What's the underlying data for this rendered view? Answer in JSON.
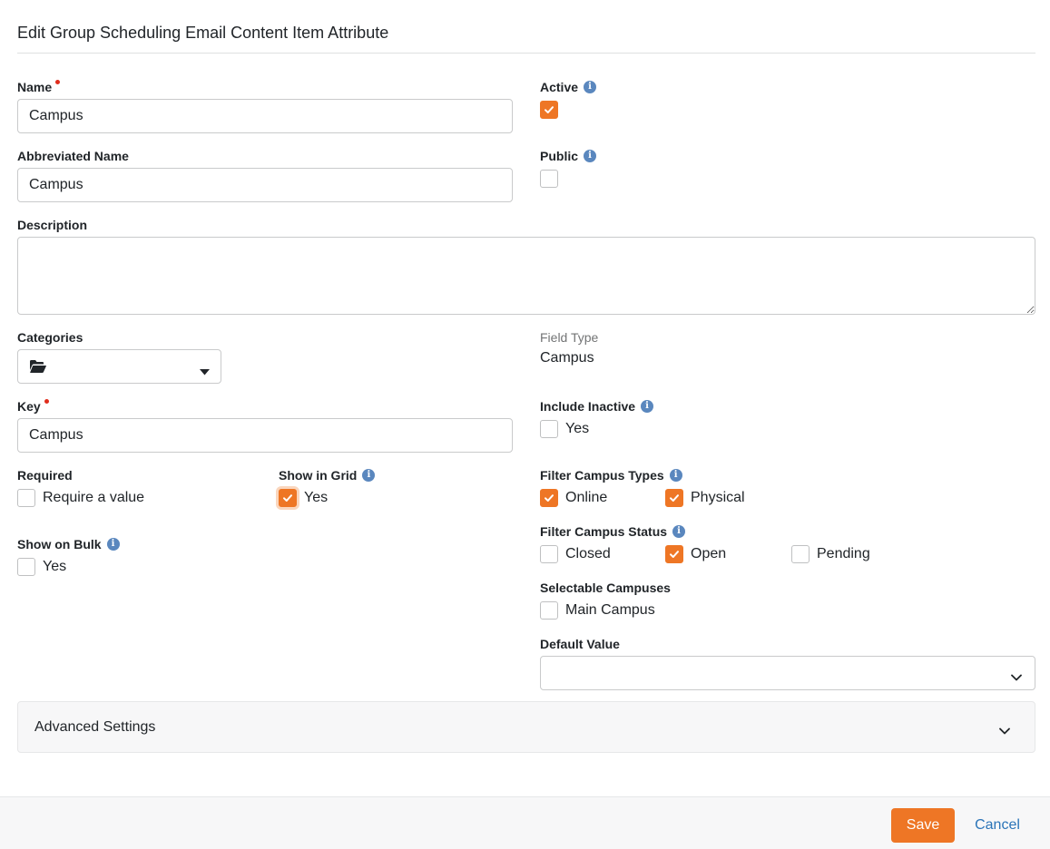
{
  "page": {
    "title": "Edit Group Scheduling Email Content Item Attribute"
  },
  "colors": {
    "accent": "#ee7625",
    "info": "#5a87be",
    "required": "#e02d1c",
    "link": "#2a74b8"
  },
  "form": {
    "name": {
      "label": "Name",
      "value": "Campus"
    },
    "abbreviated_name": {
      "label": "Abbreviated Name",
      "value": "Campus"
    },
    "description": {
      "label": "Description",
      "value": ""
    },
    "categories": {
      "label": "Categories",
      "icon": "folder-open-icon"
    },
    "key": {
      "label": "Key",
      "value": "Campus"
    },
    "required": {
      "label": "Required",
      "option": "Require a value",
      "checked": false
    },
    "show_in_grid": {
      "label": "Show in Grid",
      "option": "Yes",
      "checked": true
    },
    "show_on_bulk": {
      "label": "Show on Bulk",
      "option": "Yes",
      "checked": false
    },
    "active": {
      "label": "Active",
      "checked": true
    },
    "public": {
      "label": "Public",
      "checked": false
    },
    "field_type": {
      "label": "Field Type",
      "value": "Campus"
    },
    "include_inactive": {
      "label": "Include Inactive",
      "option": "Yes",
      "checked": false
    },
    "filter_campus_types": {
      "label": "Filter Campus Types",
      "options": [
        {
          "label": "Online",
          "checked": true
        },
        {
          "label": "Physical",
          "checked": true
        }
      ]
    },
    "filter_campus_status": {
      "label": "Filter Campus Status",
      "options": [
        {
          "label": "Closed",
          "checked": false
        },
        {
          "label": "Open",
          "checked": true
        },
        {
          "label": "Pending",
          "checked": false
        }
      ]
    },
    "selectable_campuses": {
      "label": "Selectable Campuses",
      "options": [
        {
          "label": "Main Campus",
          "checked": false
        }
      ]
    },
    "default_value": {
      "label": "Default Value",
      "value": ""
    }
  },
  "advanced": {
    "label": "Advanced Settings"
  },
  "footer": {
    "save_label": "Save",
    "cancel_label": "Cancel"
  }
}
